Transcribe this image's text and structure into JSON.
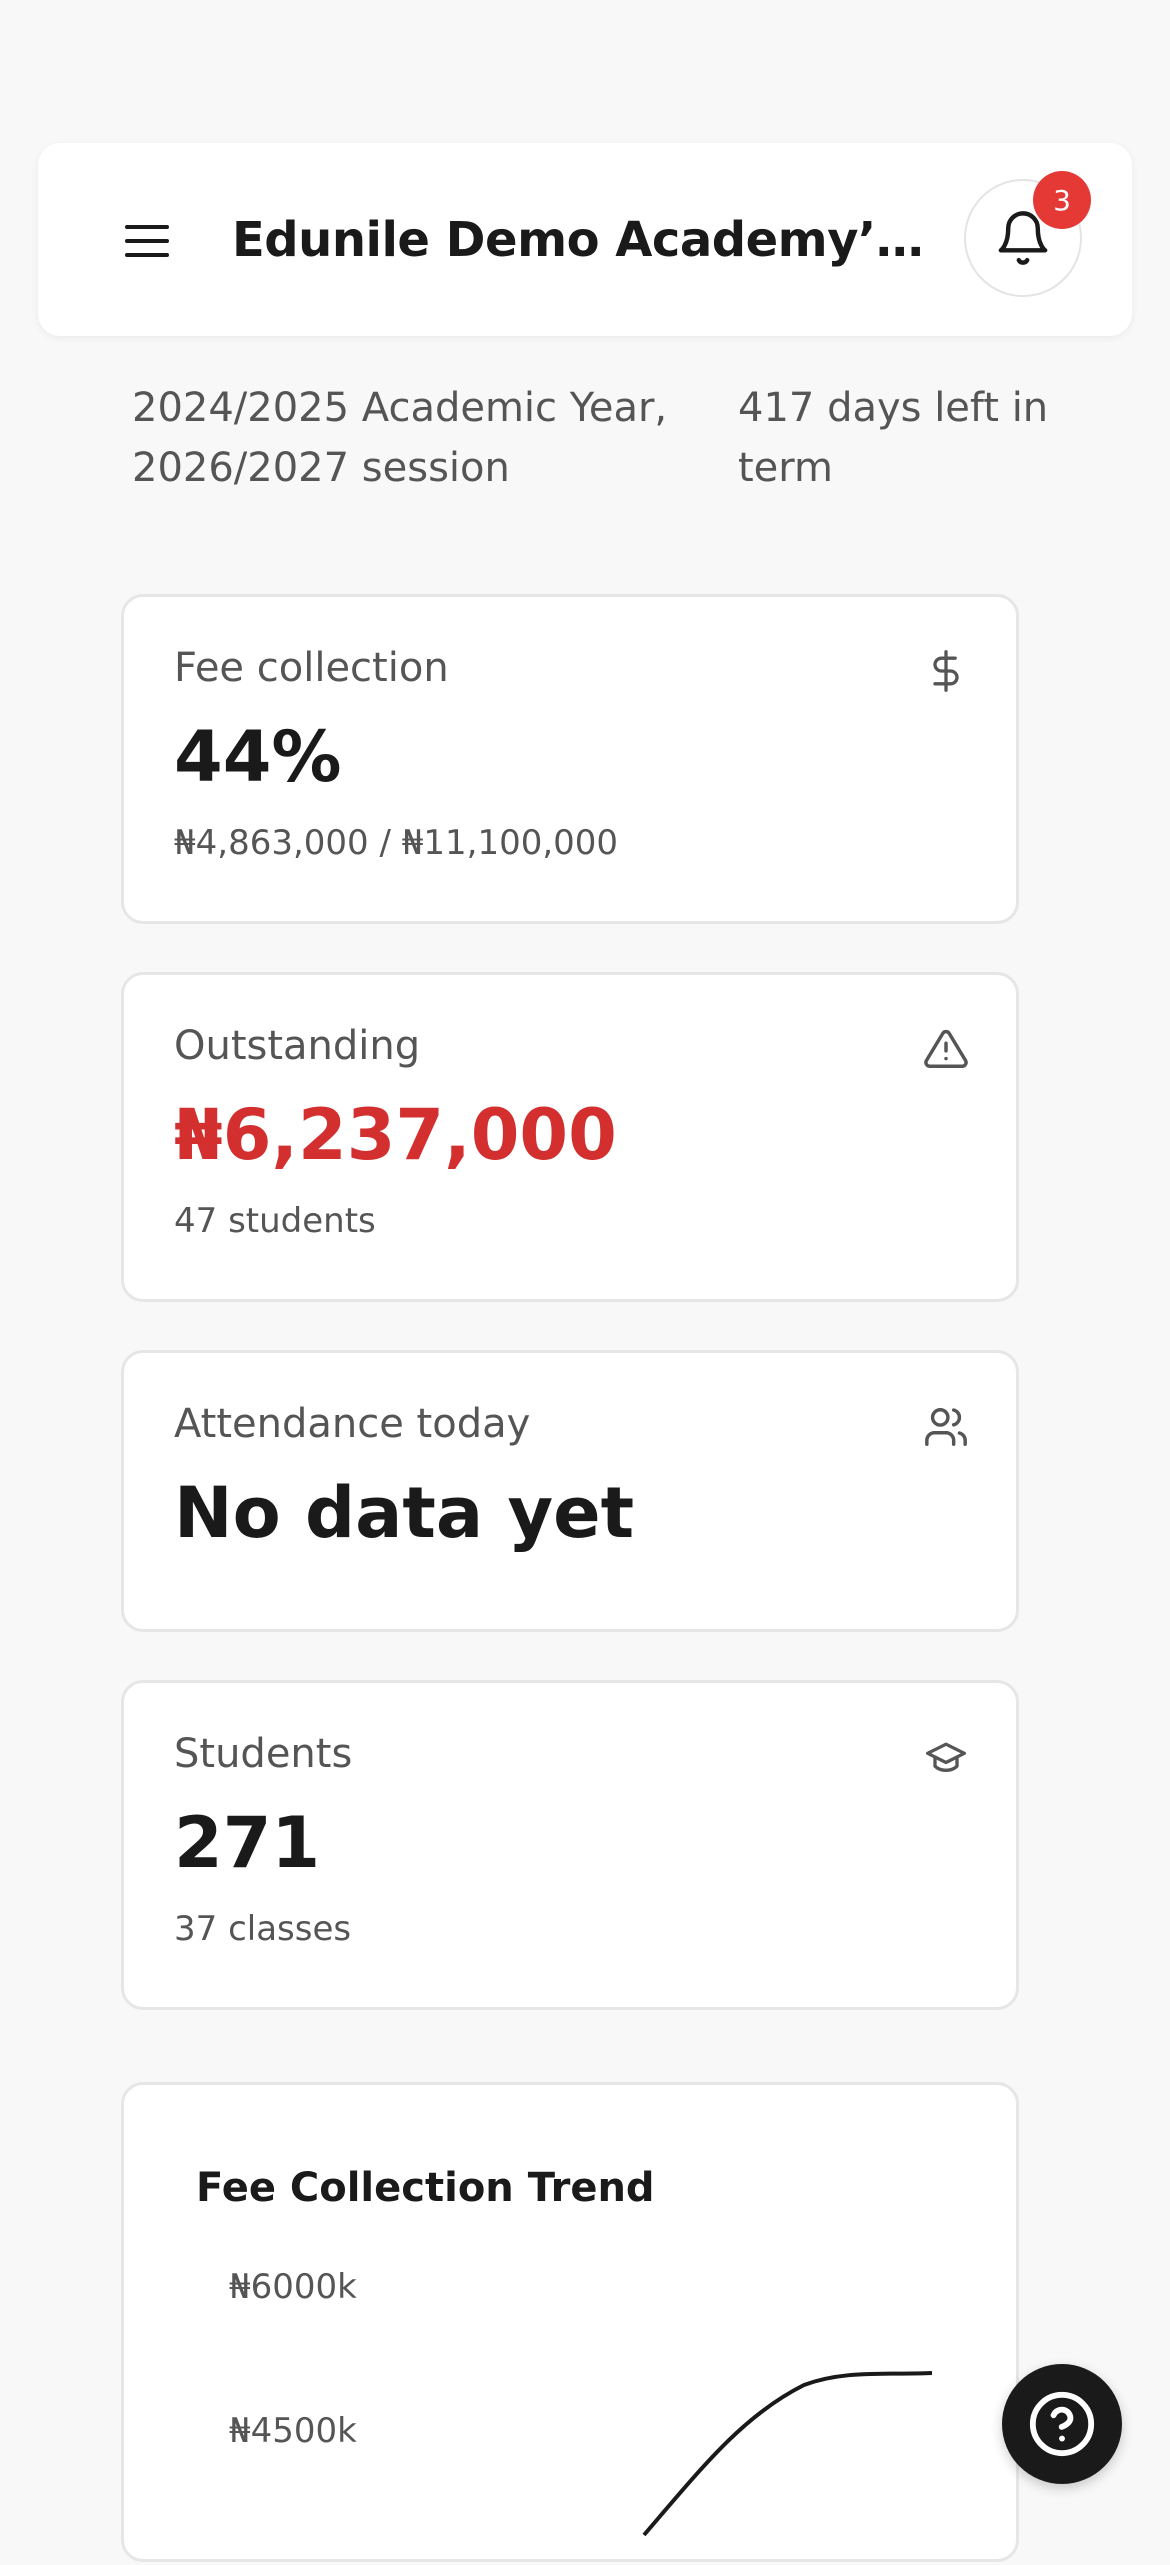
{
  "header": {
    "title": "Edunile Demo Academy’s Dashboard",
    "notification_count": "3",
    "menu_icon": "menu-icon",
    "bell_icon": "bell-icon"
  },
  "session": {
    "academic_info": "2024/2025 Academic Year, 2026/2027 session",
    "days_left": "417 days left in term"
  },
  "cards": {
    "fee_collection": {
      "label": "Fee collection",
      "value": "44%",
      "sub": "₦4,863,000 / ₦11,100,000",
      "icon": "dollar-icon"
    },
    "outstanding": {
      "label": "Outstanding",
      "value": "₦6,237,000",
      "sub": "47 students",
      "icon": "warning-icon",
      "value_color": "#d32f2f"
    },
    "attendance": {
      "label": "Attendance today",
      "value": "No data yet",
      "icon": "users-icon"
    },
    "students": {
      "label": "Students",
      "value": "271",
      "sub": "37 classes",
      "icon": "graduation-cap-icon"
    }
  },
  "help": {
    "icon": "help-icon"
  },
  "chart_data": {
    "type": "line",
    "title": "Fee Collection Trend",
    "y_ticks": [
      "₦6000k",
      "₦4500k"
    ],
    "series": [
      {
        "values": []
      }
    ]
  }
}
